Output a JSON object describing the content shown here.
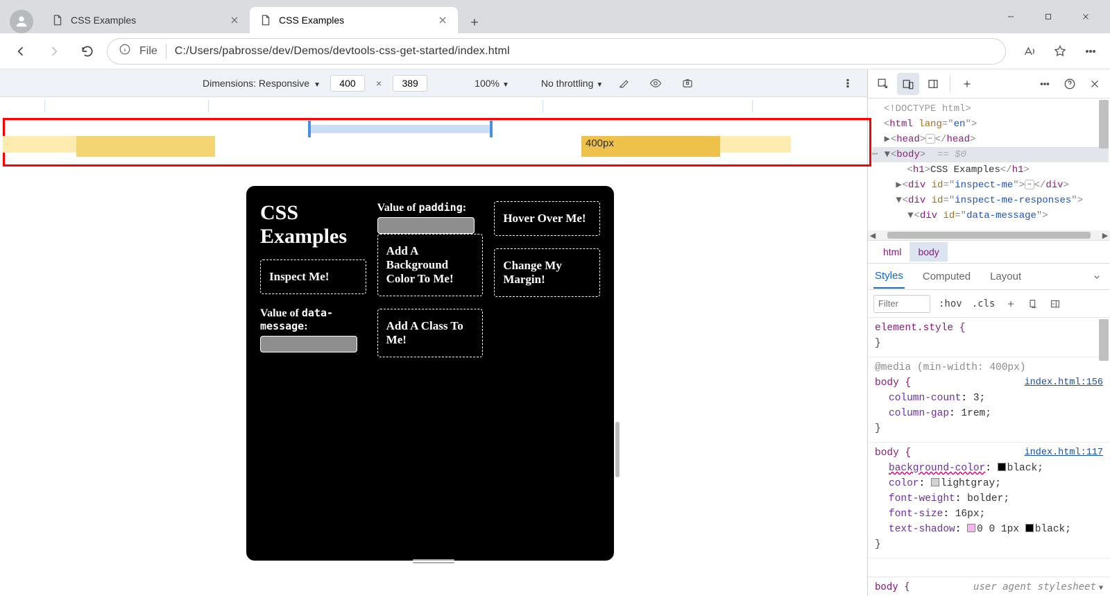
{
  "browser": {
    "tabs": [
      {
        "title": "CSS Examples",
        "active": false
      },
      {
        "title": "CSS Examples",
        "active": true
      }
    ],
    "address": {
      "scheme": "File",
      "path": "C:/Users/pabrosse/dev/Demos/devtools-css-get-started/index.html"
    }
  },
  "device_toolbar": {
    "dimensions_label": "Dimensions: Responsive",
    "width": "400",
    "height": "389",
    "zoom": "100%",
    "throttling": "No throttling"
  },
  "ruler": {
    "breakpoint_label": "400px"
  },
  "page": {
    "h1": "CSS Examples",
    "cards": {
      "inspect": "Inspect Me!",
      "bg": "Add A Background Color To Me!",
      "cls": "Add A Class To Me!",
      "hover": "Hover Over Me!",
      "margin": "Change My Margin!"
    },
    "labels": {
      "data_message_pre": "Value of ",
      "data_message_code": "data-message",
      "data_message_post": ":",
      "padding_pre": "Value of ",
      "padding_code": "padding",
      "padding_post": ":"
    }
  },
  "devtools": {
    "dom": {
      "doctype": "<!DOCTYPE html>",
      "html_open": "<html lang=\"en\">",
      "head": {
        "open": "<head>",
        "close": "</head>"
      },
      "body_open": "<body>",
      "body_ghost": "== $0",
      "h1": {
        "open": "<h1>",
        "text": "CSS Examples",
        "close": "</h1>"
      },
      "div1": {
        "open_a": "<div id=\"",
        "id": "inspect-me",
        "open_b": "\">",
        "close": "</div>"
      },
      "div2": {
        "open_a": "<div id=\"",
        "id": "inspect-me-responses",
        "open_b": "\">"
      },
      "div3": {
        "open_a": "<div id=\"",
        "id": "data-message",
        "open_b": "\">"
      }
    },
    "crumbs": [
      "html",
      "body"
    ],
    "styles_tabs": [
      "Styles",
      "Computed",
      "Layout"
    ],
    "filter_placeholder": "Filter",
    "filter_pills": [
      ":hov",
      ".cls"
    ],
    "rules": {
      "element_style": "element.style {",
      "media": "@media (min-width: 400px)",
      "r1": {
        "selector": "body {",
        "source": "index.html:156",
        "props": [
          {
            "n": "column-count",
            "v": "3;"
          },
          {
            "n": "column-gap",
            "v": "1rem;"
          }
        ]
      },
      "r2": {
        "selector": "body {",
        "source": "index.html:117",
        "props": [
          {
            "n": "background-color",
            "v": "black;",
            "sw": "black"
          },
          {
            "n": "color",
            "v": "lightgray;",
            "sw": "lg"
          },
          {
            "n": "font-weight",
            "v": "bolder;"
          },
          {
            "n": "font-size",
            "v": "16px;"
          },
          {
            "n": "text-shadow",
            "v_pre": "0 0 1px ",
            "v_post": "black;",
            "sw_pre": "pink",
            "sw_post": "black"
          }
        ]
      },
      "ua": {
        "selector": "body {",
        "label": "user agent stylesheet"
      }
    }
  }
}
